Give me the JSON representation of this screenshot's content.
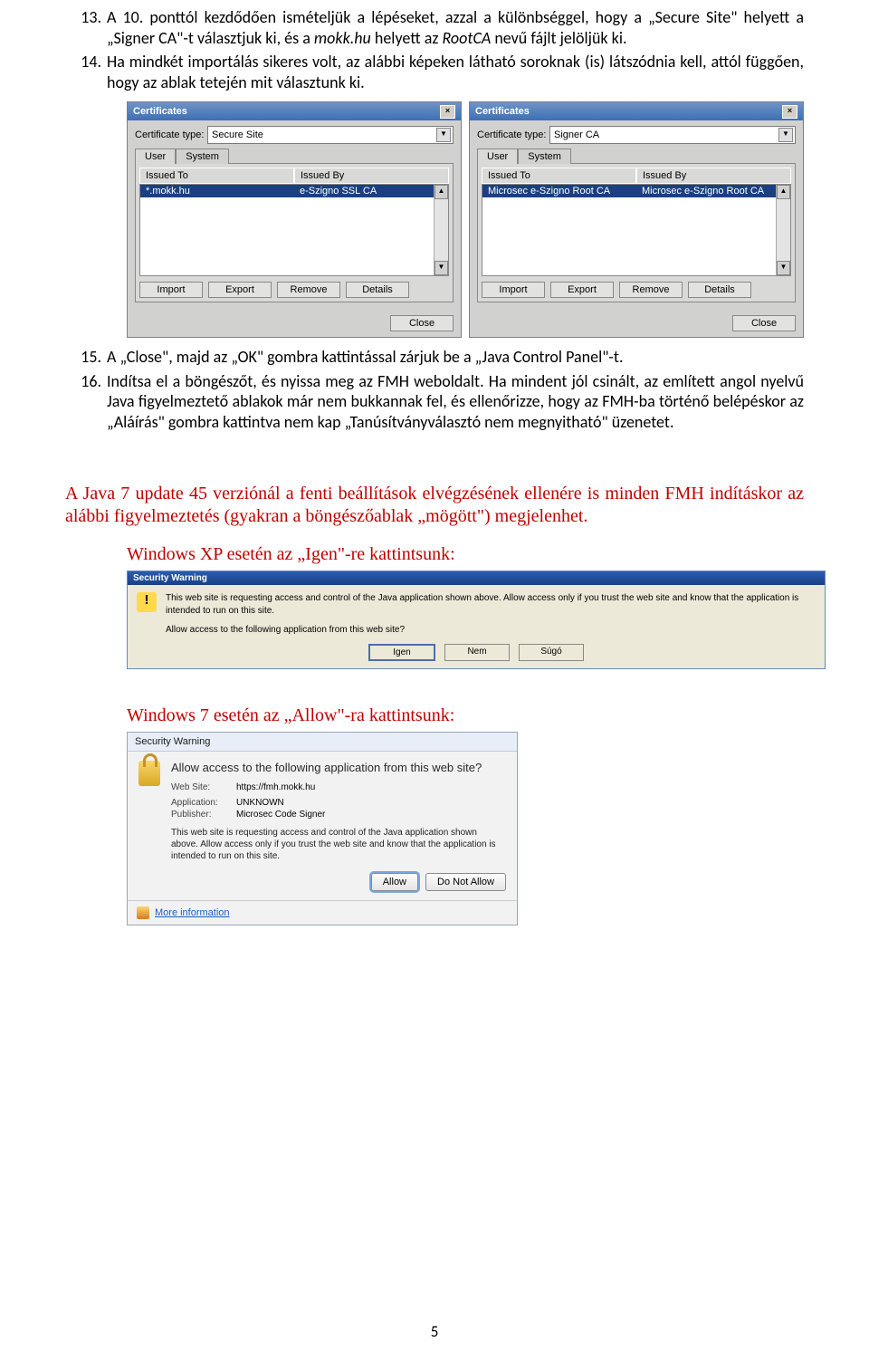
{
  "list": {
    "item13": {
      "num": "13.",
      "text_a": "A 10. ponttól kezdődően ismételjük a lépéseket, azzal a különbséggel, hogy a „Secure Site\" helyett a „Signer CA\"-t választjuk ki, és a ",
      "text_i": "mokk.hu",
      "text_b": " helyett az ",
      "text_i2": "RootCA",
      "text_c": " nevű fájlt jelöljük ki."
    },
    "item14": {
      "num": "14.",
      "text": "Ha mindkét importálás sikeres volt, az alábbi képeken látható soroknak (is) látszódnia kell, attól függően, hogy az ablak tetején mit választunk ki."
    },
    "item15": {
      "num": "15.",
      "text": "A „Close\", majd az „OK\" gombra kattintással zárjuk be a „Java Control Panel\"-t."
    },
    "item16": {
      "num": "16.",
      "text": "Indítsa el a böngészőt, és nyissa meg az FMH weboldalt. Ha mindent jól csinált, az említett angol nyelvű Java figyelmeztető ablakok már nem bukkannak fel, és ellenőrizze, hogy az FMH-ba történő belépéskor az „Aláírás\" gombra kattintva nem kap „Tanúsítványválasztó nem megnyitható\" üzenetet."
    }
  },
  "dlg_left": {
    "title": "Certificates",
    "cert_type_label": "Certificate type:",
    "cert_type_value": "Secure Site",
    "tab_user": "User",
    "tab_system": "System",
    "col_issued_to": "Issued To",
    "col_issued_by": "Issued By",
    "row_to": "*.mokk.hu",
    "row_by": "e-Szigno SSL CA",
    "btn_import": "Import",
    "btn_export": "Export",
    "btn_remove": "Remove",
    "btn_details": "Details",
    "btn_close": "Close"
  },
  "dlg_right": {
    "title": "Certificates",
    "cert_type_label": "Certificate type:",
    "cert_type_value": "Signer CA",
    "tab_user": "User",
    "tab_system": "System",
    "col_issued_to": "Issued To",
    "col_issued_by": "Issued By",
    "row_to": "Microsec e-Szigno Root CA",
    "row_by": "Microsec e-Szigno Root CA",
    "btn_import": "Import",
    "btn_export": "Export",
    "btn_remove": "Remove",
    "btn_details": "Details",
    "btn_close": "Close"
  },
  "red_para": "A Java 7 update 45 verziónál a fenti beállítások elvégzésének ellenére is minden FMH indításkor az alábbi figyelmeztetés (gyakran a böngészőablak „mögött\") megjelenhet.",
  "red_xp": "Windows XP esetén az „Igen\"-re kattintsunk:",
  "red_w7": "Windows 7 esetén az „Allow\"-ra kattintsunk:",
  "xp": {
    "title": "Security Warning",
    "line1": "This web site is requesting access and control of the Java application shown above. Allow access only if you trust the web site and know that the application is intended to run on this site.",
    "line2": "Allow access to the following application from this web site?",
    "btn_yes": "Igen",
    "btn_no": "Nem",
    "btn_help": "Súgó"
  },
  "w7": {
    "title": "Security Warning",
    "question": "Allow access to the following application from this web site?",
    "k_website": "Web Site:",
    "v_website": "https://fmh.mokk.hu",
    "k_app": "Application:",
    "v_app": "UNKNOWN",
    "k_pub": "Publisher:",
    "v_pub": "Microsec Code Signer",
    "desc": "This web site is requesting access and control of the Java application shown above. Allow access only if you trust the web site and know that the application is intended to run on this site.",
    "btn_allow": "Allow",
    "btn_deny": "Do Not Allow",
    "more": "More information"
  },
  "page_number": "5"
}
